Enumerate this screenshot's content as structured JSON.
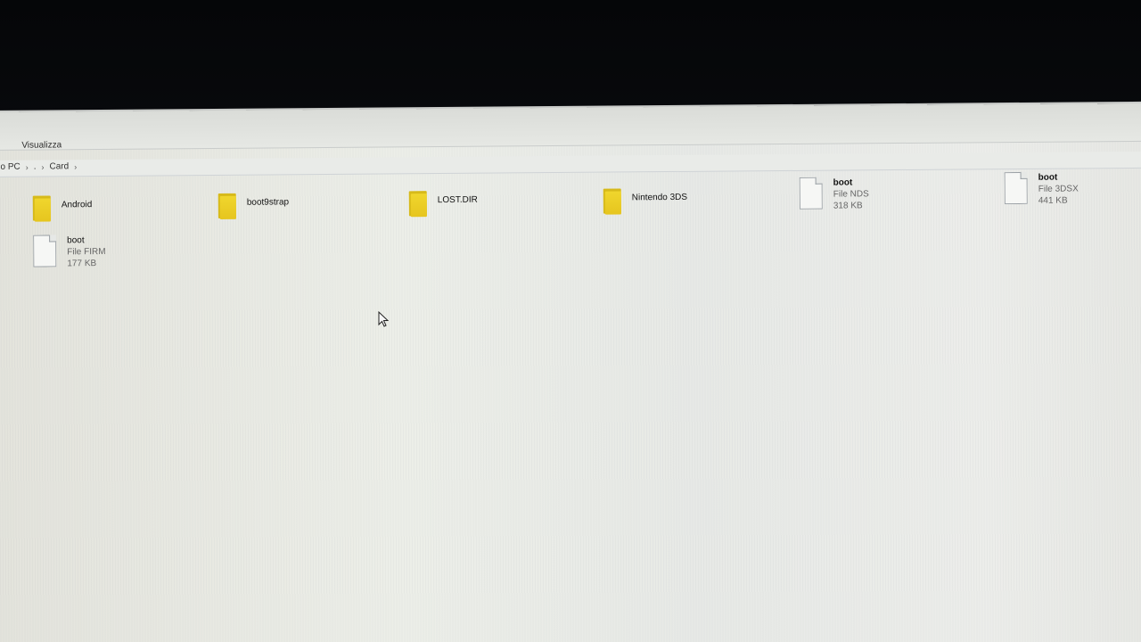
{
  "ribbon": {
    "tab_view": "Visualizza"
  },
  "breadcrumb": {
    "items": [
      "o PC",
      ".",
      "Card"
    ]
  },
  "files": [
    {
      "name": "Android",
      "type": "folder"
    },
    {
      "name": "boot9strap",
      "type": "folder"
    },
    {
      "name": "LOST.DIR",
      "type": "folder"
    },
    {
      "name": "Nintendo 3DS",
      "type": "folder"
    },
    {
      "name": "boot",
      "type": "file",
      "kind": "File NDS",
      "size": "318 KB"
    },
    {
      "name": "boot",
      "type": "file",
      "kind": "File 3DSX",
      "size": "441 KB"
    },
    {
      "name": "boot",
      "type": "file",
      "kind": "File FIRM",
      "size": "177 KB"
    }
  ],
  "colors": {
    "folder": "#e6c51f",
    "background": "#eceee8"
  },
  "icons": [
    "folder-icon",
    "file-icon",
    "chevron-right-icon",
    "mouse-cursor-icon"
  ]
}
